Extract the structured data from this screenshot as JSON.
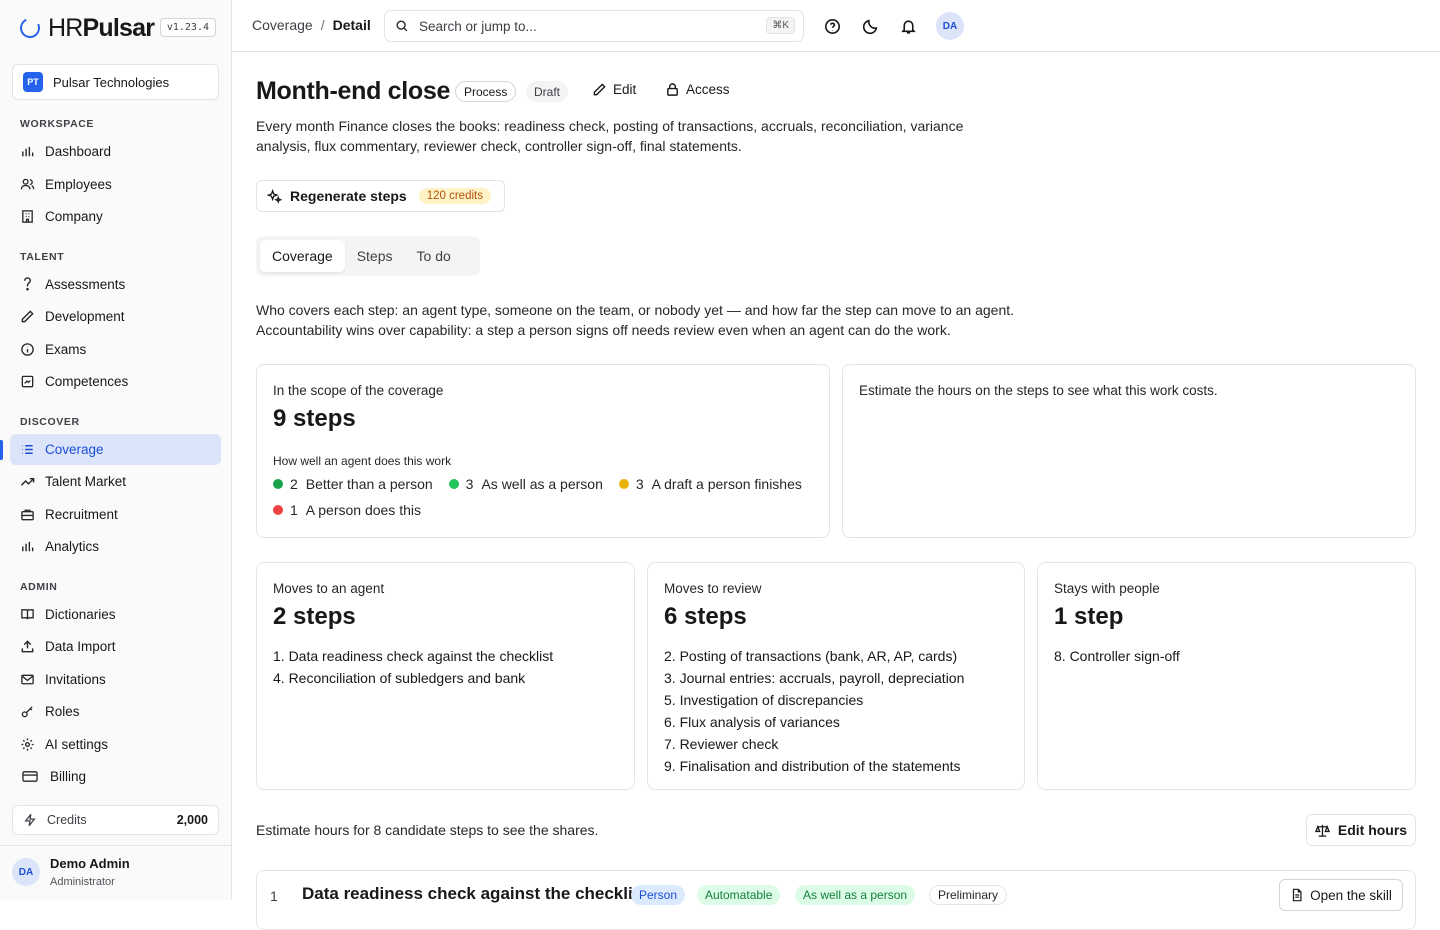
{
  "app": {
    "brand_light": "HR",
    "brand_bold": "Pulsar",
    "version": "v1.23.4"
  },
  "org": {
    "initials": "PT",
    "name": "Pulsar Technologies"
  },
  "sidebar": {
    "sections": [
      {
        "label": "WORKSPACE",
        "items": [
          {
            "label": "Dashboard",
            "icon": "bar-chart-icon"
          },
          {
            "label": "Employees",
            "icon": "users-icon"
          },
          {
            "label": "Company",
            "icon": "building-icon"
          }
        ]
      },
      {
        "label": "TALENT",
        "items": [
          {
            "label": "Assessments",
            "icon": "hook-icon"
          },
          {
            "label": "Development",
            "icon": "pencil-icon"
          },
          {
            "label": "Exams",
            "icon": "info-circle-icon"
          },
          {
            "label": "Competences",
            "icon": "image-frame-icon"
          }
        ]
      },
      {
        "label": "DISCOVER",
        "items": [
          {
            "label": "Coverage",
            "icon": "list-icon",
            "active": true
          },
          {
            "label": "Talent Market",
            "icon": "trending-up-icon"
          },
          {
            "label": "Recruitment",
            "icon": "briefcase-icon"
          },
          {
            "label": "Analytics",
            "icon": "bar-chart-icon"
          }
        ]
      },
      {
        "label": "ADMIN",
        "items": [
          {
            "label": "Dictionaries",
            "icon": "book-icon"
          },
          {
            "label": "Data Import",
            "icon": "upload-icon"
          },
          {
            "label": "Invitations",
            "icon": "mail-icon"
          },
          {
            "label": "Roles",
            "icon": "key-icon"
          },
          {
            "label": "AI settings",
            "icon": "gear-icon"
          },
          {
            "label": "Billing",
            "icon": "credit-card-icon"
          }
        ]
      }
    ],
    "credits_label": "Credits",
    "credits_value": "2,000",
    "user": {
      "initials": "DA",
      "name": "Demo Admin",
      "role": "Administrator"
    }
  },
  "topbar": {
    "breadcrumb": [
      "Coverage",
      "/",
      "Detail"
    ],
    "search_placeholder": "Search or jump to...",
    "search_shortcut": "⌘K",
    "avatar_initials": "DA"
  },
  "page": {
    "title": "Month-end close",
    "chip_type": "Process",
    "chip_status": "Draft",
    "edit_label": "Edit",
    "access_label": "Access",
    "description": "Every month Finance closes the books: readiness check, posting of transactions, accruals, reconciliation, variance analysis, flux commentary, reviewer check, controller sign-off, final statements.",
    "regen_label": "Regenerate steps",
    "regen_cost": "120 credits",
    "tabs": [
      "Coverage",
      "Steps",
      "To do"
    ],
    "intro": "Who covers each step: an agent type, someone on the team, or nobody yet — and how far the step can move to an agent. Accountability wins over capability: a step a person signs off needs review even when an agent can do the work."
  },
  "scope": {
    "label": "In the scope of the coverage",
    "value": "9 steps",
    "sub": "How well an agent does this work",
    "legend": [
      {
        "count": "2",
        "label": "Better than a person",
        "color": "#16a34a"
      },
      {
        "count": "3",
        "label": "As well as a person",
        "color": "#22c55e"
      },
      {
        "count": "3",
        "label": "A draft a person finishes",
        "color": "#eab308"
      },
      {
        "count": "1",
        "label": "A person does this",
        "color": "#ef4444"
      }
    ]
  },
  "cost": {
    "text": "Estimate the hours on the steps to see what this work costs."
  },
  "buckets": [
    {
      "label": "Moves to an agent",
      "value": "2 steps",
      "steps": [
        "1. Data readiness check against the checklist",
        "4. Reconciliation of subledgers and bank"
      ]
    },
    {
      "label": "Moves to review",
      "value": "6 steps",
      "steps": [
        "2. Posting of transactions (bank, AR, AP, cards)",
        "3. Journal entries: accruals, payroll, depreciation",
        "5. Investigation of discrepancies",
        "6. Flux analysis of variances",
        "7. Reviewer check",
        "9. Finalisation and distribution of the statements"
      ]
    },
    {
      "label": "Stays with people",
      "value": "1 step",
      "steps": [
        "8. Controller sign-off"
      ]
    }
  ],
  "estimate": {
    "text": "Estimate hours for 8 candidate steps to see the shares.",
    "edit_hours_label": "Edit hours"
  },
  "first_row": {
    "number": "1",
    "title": "Data readiness check against the checklist",
    "tags": [
      "Person",
      "Automatable",
      "As well as a person",
      "Preliminary"
    ],
    "open_label": "Open the skill"
  }
}
